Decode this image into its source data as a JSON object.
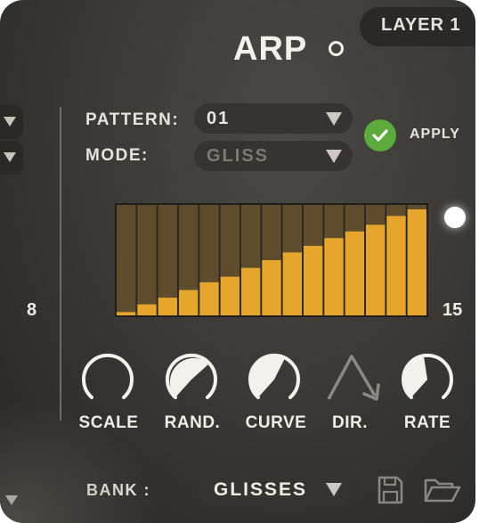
{
  "layer": {
    "label": "LAYER 1"
  },
  "header": {
    "title": "ARP"
  },
  "side": {
    "value_left": "8",
    "value_right": "15"
  },
  "pattern": {
    "label": "PATTERN:",
    "value": "01"
  },
  "mode": {
    "label": "MODE:",
    "value": "GLISS"
  },
  "apply": {
    "label": "APPLY"
  },
  "steps": {
    "count": 15,
    "levels": [
      0.03,
      0.1,
      0.16,
      0.23,
      0.3,
      0.35,
      0.43,
      0.5,
      0.57,
      0.63,
      0.7,
      0.76,
      0.82,
      0.9,
      0.96
    ],
    "fill_color": "#e6a62c",
    "bg_color": "#5e4c2c"
  },
  "knobs": [
    {
      "name": "scale",
      "label": "SCALE",
      "level": 0.0
    },
    {
      "name": "rand",
      "label": "RAND.",
      "level": 0.7
    },
    {
      "name": "curve",
      "label": "CURVE",
      "level": 0.62
    },
    {
      "name": "dir",
      "label": "DIR."
    },
    {
      "name": "rate",
      "label": "RATE",
      "level": 0.4
    }
  ],
  "bank": {
    "label": "BANK :",
    "value": "GLISSES"
  },
  "icons": {
    "save": "save-icon",
    "open": "folder-open-icon",
    "power": "power-icon",
    "apply": "check-icon"
  }
}
